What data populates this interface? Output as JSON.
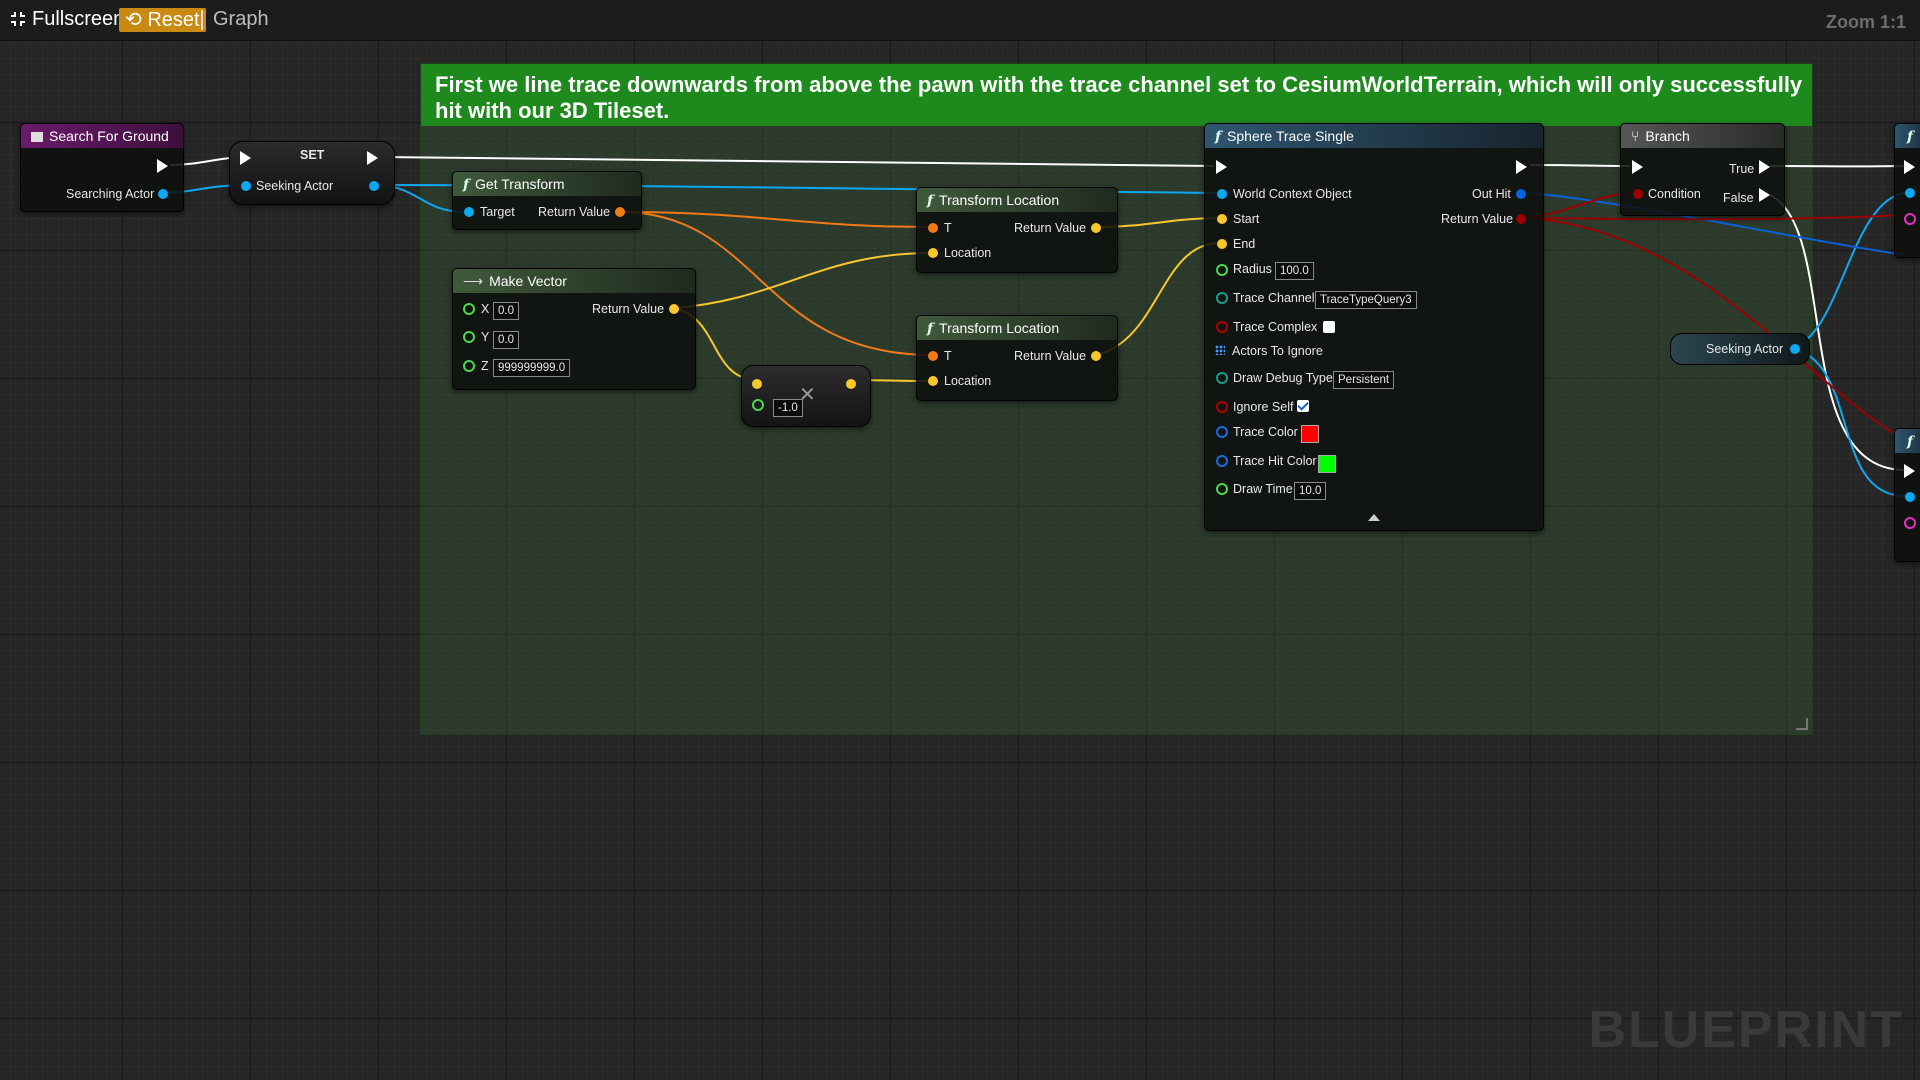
{
  "topbar": {
    "fullscreen_label": "Fullscreen",
    "reset_label": "Reset",
    "graph_tab": "Graph",
    "zoom": "Zoom 1:1"
  },
  "comment": {
    "text": "First we line trace downwards from above the pawn with the trace channel set to CesiumWorldTerrain, which will only successfully hit with our 3D Tileset."
  },
  "nodes": {
    "search_for_ground": {
      "title": "Search For Ground",
      "pin_searching_actor": "Searching Actor"
    },
    "set": {
      "title": "SET",
      "pin_seeking_actor": "Seeking Actor"
    },
    "get_transform": {
      "title": "Get Transform",
      "pin_target": "Target",
      "pin_return": "Return Value"
    },
    "make_vector": {
      "title": "Make Vector",
      "pin_x": "X",
      "pin_y": "Y",
      "pin_z": "Z",
      "x": "0.0",
      "y": "0.0",
      "z": "999999999.0",
      "pin_return": "Return Value"
    },
    "multiply": {
      "value": "-1.0"
    },
    "transform_location_1": {
      "title": "Transform Location",
      "pin_t": "T",
      "pin_location": "Location",
      "pin_return": "Return Value"
    },
    "transform_location_2": {
      "title": "Transform Location",
      "pin_t": "T",
      "pin_location": "Location",
      "pin_return": "Return Value"
    },
    "sphere_trace": {
      "title": "Sphere Trace Single",
      "pin_world_context": "World Context Object",
      "pin_start": "Start",
      "pin_end": "End",
      "pin_radius": "Radius",
      "radius": "100.0",
      "pin_trace_channel": "Trace Channel",
      "trace_channel": "TraceTypeQuery3",
      "pin_trace_complex": "Trace Complex",
      "pin_actors_to_ignore": "Actors To Ignore",
      "pin_draw_debug": "Draw Debug Type",
      "draw_debug": "Persistent",
      "pin_ignore_self": "Ignore Self",
      "pin_trace_color": "Trace Color",
      "trace_color": "#ff0000",
      "pin_trace_hit_color": "Trace Hit Color",
      "trace_hit_color": "#00ff00",
      "pin_draw_time": "Draw Time",
      "draw_time": "10.0",
      "pin_out_hit": "Out Hit",
      "pin_return": "Return Value"
    },
    "branch": {
      "title": "Branch",
      "pin_condition": "Condition",
      "pin_true": "True",
      "pin_false": "False"
    },
    "seeking_actor_var": {
      "label": "Seeking Actor"
    },
    "partial_node_icon": "f"
  },
  "watermark": "BLUEPRINT"
}
